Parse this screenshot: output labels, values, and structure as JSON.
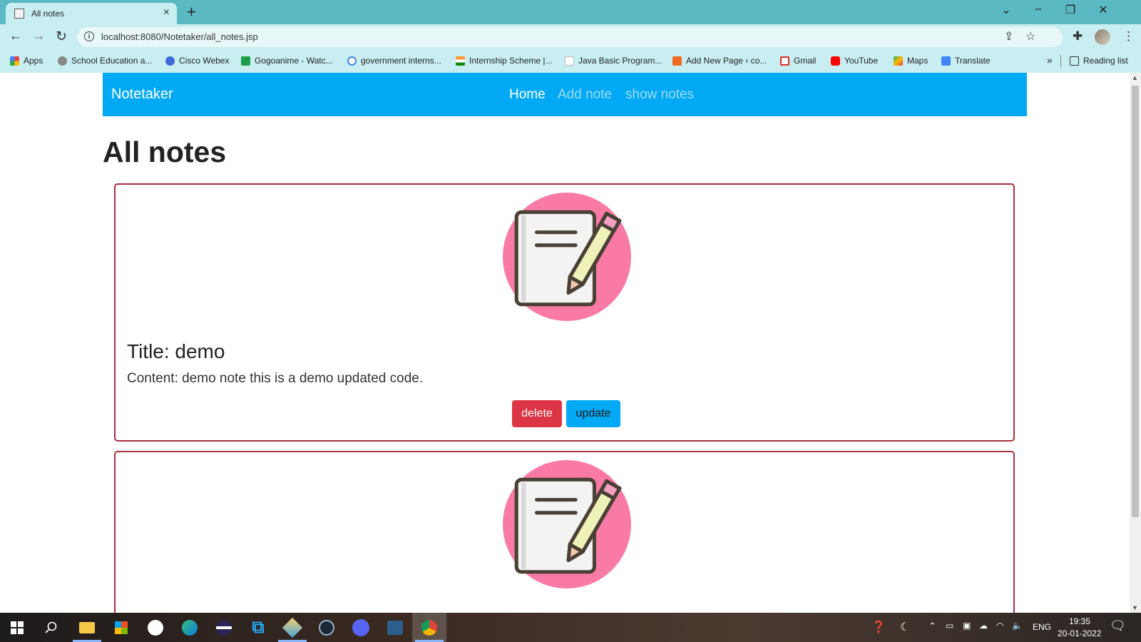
{
  "browser": {
    "tab_title": "All notes",
    "url": "localhost:8080/Notetaker/all_notes.jsp",
    "bookmarks": [
      {
        "label": "Apps",
        "icon": "apps-grid-icon",
        "color": "#e8453c"
      },
      {
        "label": "School Education a...",
        "icon": "school-icon",
        "color": "#888888"
      },
      {
        "label": "Cisco Webex",
        "icon": "webex-icon",
        "color": "#3b6ad8"
      },
      {
        "label": "Gogoanime - Watc...",
        "icon": "gogoanime-icon",
        "color": "#1e9e4a"
      },
      {
        "label": "government interns...",
        "icon": "google-icon",
        "color": "#4285f4"
      },
      {
        "label": "Internship Scheme |...",
        "icon": "india-flag-icon",
        "color": "#ff9933"
      },
      {
        "label": "Java Basic Program...",
        "icon": "w3r-icon",
        "color": "#ffffff"
      },
      {
        "label": "Add New Page ‹ co...",
        "icon": "wordpress-icon",
        "color": "#f26b21"
      },
      {
        "label": "Gmail",
        "icon": "gmail-icon",
        "color": "#d93025"
      },
      {
        "label": "YouTube",
        "icon": "youtube-icon",
        "color": "#ff0000"
      },
      {
        "label": "Maps",
        "icon": "maps-icon",
        "color": "#34a853"
      },
      {
        "label": "Translate",
        "icon": "translate-icon",
        "color": "#4285f4"
      }
    ],
    "more_bookmarks": "»",
    "reading_list": "Reading list"
  },
  "navbar": {
    "brand": "Notetaker",
    "links": [
      {
        "label": "Home",
        "active": true
      },
      {
        "label": "Add note",
        "active": false
      },
      {
        "label": "show notes",
        "active": false
      }
    ],
    "color": "#03a9f4"
  },
  "page": {
    "heading": "All notes"
  },
  "notes": [
    {
      "title": "Title: demo",
      "content": "Content: demo note this is a demo updated code.",
      "delete_label": "delete",
      "update_label": "update"
    }
  ],
  "taskbar": {
    "language": "ENG",
    "time": "19:35",
    "date": "20-01-2022"
  },
  "colors": {
    "delete": "#dc3545",
    "update": "#03a9f4",
    "card_border": "#a8323e",
    "illustration_circle": "#f97aa4"
  }
}
